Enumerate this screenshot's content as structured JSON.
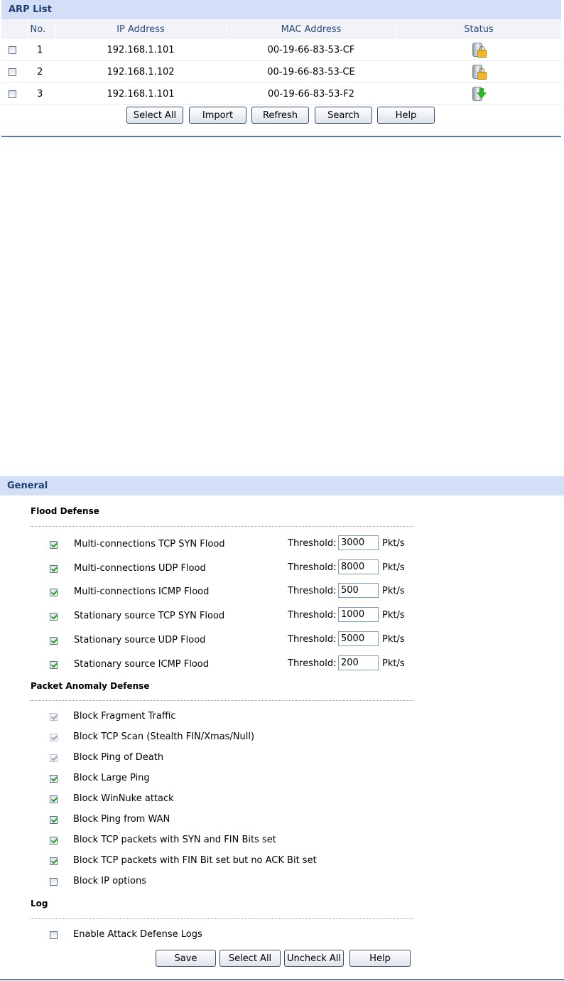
{
  "arp": {
    "title": "ARP List",
    "columns": [
      "No.",
      "IP Address",
      "MAC Address",
      "Status"
    ],
    "rows": [
      {
        "no": "1",
        "ip": "192.168.1.101",
        "mac": "00-19-66-83-53-CF",
        "status_icon": "bound-lock-icon"
      },
      {
        "no": "2",
        "ip": "192.168.1.102",
        "mac": "00-19-66-83-53-CE",
        "status_icon": "bound-lock-icon"
      },
      {
        "no": "3",
        "ip": "192.168.1.101",
        "mac": "00-19-66-83-53-F2",
        "status_icon": "imported-arrow-icon"
      }
    ],
    "buttons": {
      "select_all": "Select All",
      "import": "Import",
      "refresh": "Refresh",
      "search": "Search",
      "help": "Help"
    }
  },
  "general": {
    "title": "General",
    "flood": {
      "heading": "Flood Defense",
      "threshold_label": "Threshold:",
      "unit": "Pkt/s",
      "items": [
        {
          "label": "Multi-connections TCP SYN Flood",
          "checked": true,
          "value": "3000"
        },
        {
          "label": "Multi-connections UDP Flood",
          "checked": true,
          "value": "8000"
        },
        {
          "label": "Multi-connections ICMP Flood",
          "checked": true,
          "value": "500"
        },
        {
          "label": "Stationary source TCP SYN Flood",
          "checked": true,
          "value": "1000"
        },
        {
          "label": "Stationary source UDP Flood",
          "checked": true,
          "value": "5000"
        },
        {
          "label": "Stationary source ICMP Flood",
          "checked": true,
          "value": "200"
        }
      ]
    },
    "anomaly": {
      "heading": "Packet Anomaly Defense",
      "items": [
        {
          "label": "Block Fragment Traffic",
          "checked": true,
          "disabled": true
        },
        {
          "label": "Block TCP Scan (Stealth FIN/Xmas/Null)",
          "checked": true,
          "disabled": true
        },
        {
          "label": "Block Ping of Death",
          "checked": true,
          "disabled": true
        },
        {
          "label": "Block Large Ping",
          "checked": true,
          "disabled": false
        },
        {
          "label": "Block WinNuke attack",
          "checked": true,
          "disabled": false
        },
        {
          "label": "Block Ping from WAN",
          "checked": true,
          "disabled": false
        },
        {
          "label": "Block TCP packets with SYN and FIN Bits set",
          "checked": true,
          "disabled": false
        },
        {
          "label": "Block TCP packets with FIN Bit set but no ACK Bit set",
          "checked": true,
          "disabled": false
        },
        {
          "label": "Block IP options",
          "checked": false,
          "disabled": false
        }
      ]
    },
    "log": {
      "heading": "Log",
      "label": "Enable Attack Defense Logs",
      "checked": false
    },
    "buttons": {
      "save": "Save",
      "select_all": "Select All",
      "uncheck_all": "Uncheck All",
      "help": "Help"
    }
  }
}
